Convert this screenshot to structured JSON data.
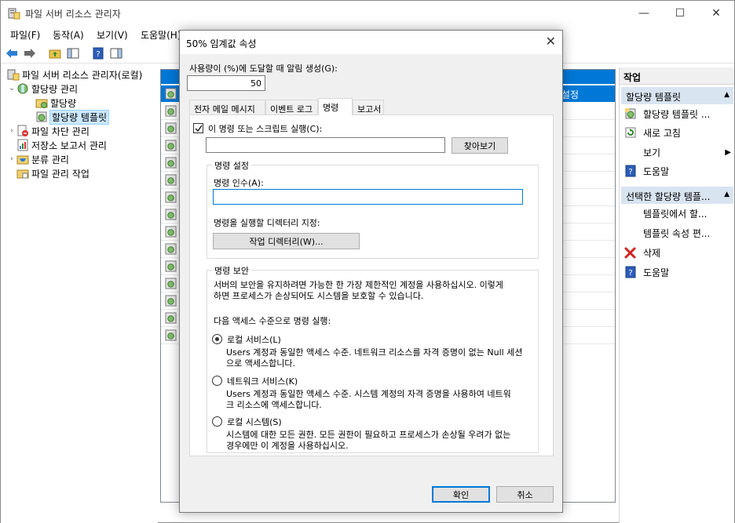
{
  "window": {
    "title": "파일 서버 리소스 관리자",
    "controls": {
      "minimize": "—",
      "maximize": "☐",
      "close": "✕"
    }
  },
  "menu": [
    "파일(F)",
    "동작(A)",
    "보기(V)",
    "도움말(H)"
  ],
  "tree": {
    "root": "파일 서버 리소스 관리자(로컬)",
    "quota_mgmt": "할당량 관리",
    "quotas": "할당량",
    "quota_templates": "할당량 템플릿",
    "file_screening": "파일 차단 관리",
    "storage_reports": "저장소 보고서 관리",
    "classification": "분류 관리",
    "file_mgmt_tasks": "파일 관리 작업"
  },
  "list": {
    "selected_text": "설정"
  },
  "actions": {
    "header": "작업",
    "section1": "할당량 템플릿",
    "s1_items": [
      "할당량 템플릿 ...",
      "새로 고침",
      "보기",
      "도움말"
    ],
    "section2": "선택한 할당량 템플...",
    "s2_items": [
      "템플릿에서 할...",
      "템플릿 속성 편...",
      "삭제",
      "도움말"
    ]
  },
  "dialog": {
    "title": "50% 임계값 속성",
    "close": "✕",
    "threshold_label": "사용량이 (%)에 도달할 때 알림 생성(G):",
    "threshold_value": "50",
    "tabs": [
      "전자 메일 메시지",
      "이벤트 로그",
      "명령",
      "보고서"
    ],
    "run_command_label": "이 명령 또는 스크립트 실행(C):",
    "command_path": "",
    "browse": "찾아보기",
    "settings_group": "명령 설정",
    "args_label": "명령 인수(A):",
    "args_value": "",
    "workdir_label": "명령을 실행할 디렉터리 지정:",
    "workdir_button": "작업 디렉터리(W)...",
    "security_group": "명령 보안",
    "security_desc1": "서버의 보안을 유지하려면 가능한 한 가장 제한적인 계정을 사용하십시오. 이렇게",
    "security_desc2": "하면 프로세스가 손상되어도 시스템을 보호할 수 있습니다.",
    "access_label": "다음 액세스 수준으로 명령 실행:",
    "local_service": "로컬 서비스(L)",
    "local_service_desc1": "Users 계정과 동일한 액세스 수준. 네트워크 리소스를 자격 증명이 없는 Null 세션",
    "local_service_desc2": "으로 액세스합니다.",
    "network_service": "네트워크 서비스(K)",
    "network_service_desc1": "Users 계정과 동일한 액세스 수준. 시스템 계정의 자격 증명을 사용하여 네트워",
    "network_service_desc2": "크 리소스에 액세스합니다.",
    "local_system": "로컬 시스템(S)",
    "local_system_desc1": "시스템에 대한 모든 권한. 모든 권한이 필요하고 프로세스가 손상될 우려가 없는",
    "local_system_desc2": "경우에만 이 계정을 사용하십시오.",
    "ok": "확인",
    "cancel": "취소"
  }
}
